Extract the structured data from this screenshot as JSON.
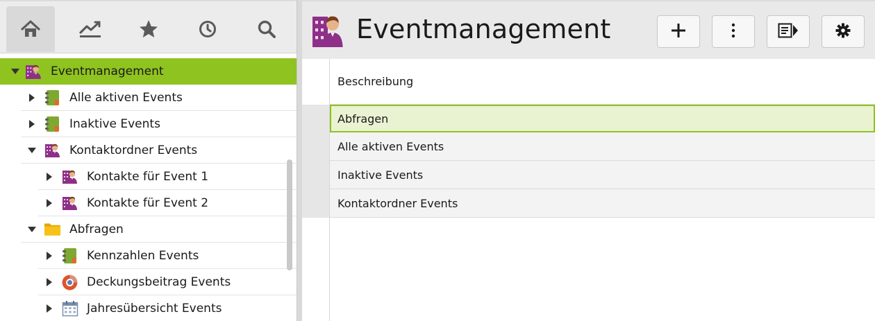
{
  "sidebar": {
    "tabs": [
      {
        "name": "home-icon",
        "active": true
      },
      {
        "name": "chart-trend-icon",
        "active": false
      },
      {
        "name": "star-icon",
        "active": false
      },
      {
        "name": "clock-icon",
        "active": false
      },
      {
        "name": "search-icon",
        "active": false
      }
    ],
    "tree": [
      {
        "label": "Eventmanagement",
        "level": 0,
        "expanded": true,
        "selected": true,
        "icon": "contact-folder-icon"
      },
      {
        "label": "Alle aktiven Events",
        "level": 1,
        "expanded": false,
        "selected": false,
        "icon": "notebook-icon"
      },
      {
        "label": "Inaktive Events",
        "level": 1,
        "expanded": false,
        "selected": false,
        "icon": "notebook-icon"
      },
      {
        "label": "Kontaktordner Events",
        "level": 1,
        "expanded": true,
        "selected": false,
        "icon": "contact-folder-icon"
      },
      {
        "label": "Kontakte für Event 1",
        "level": 2,
        "expanded": false,
        "selected": false,
        "icon": "contact-folder-icon"
      },
      {
        "label": "Kontakte für Event 2",
        "level": 2,
        "expanded": false,
        "selected": false,
        "icon": "contact-folder-icon"
      },
      {
        "label": "Abfragen",
        "level": 1,
        "expanded": true,
        "selected": false,
        "icon": "folder-icon"
      },
      {
        "label": "Kennzahlen Events",
        "level": 2,
        "expanded": false,
        "selected": false,
        "icon": "notebook-icon"
      },
      {
        "label": "Deckungsbeitrag Events",
        "level": 2,
        "expanded": false,
        "selected": false,
        "icon": "donut-chart-icon"
      },
      {
        "label": "Jahresübersicht Events",
        "level": 2,
        "expanded": false,
        "selected": false,
        "icon": "calendar-icon"
      }
    ]
  },
  "main": {
    "title": "Eventmanagement",
    "title_icon": "contact-folder-icon",
    "toolbar": [
      {
        "name": "add-button",
        "icon": "plus-icon"
      },
      {
        "name": "more-button",
        "icon": "vertical-dots-icon"
      },
      {
        "name": "details-panel-button",
        "icon": "panel-arrow-icon"
      },
      {
        "name": "settings-button",
        "icon": "gear-icon"
      }
    ],
    "grid": {
      "column_header": "Beschreibung",
      "rows": [
        {
          "label": "Abfragen",
          "selected": true
        },
        {
          "label": "Alle aktiven Events",
          "selected": false
        },
        {
          "label": "Inaktive Events",
          "selected": false
        },
        {
          "label": "Kontaktordner Events",
          "selected": false
        }
      ]
    }
  },
  "colors": {
    "accent_green": "#8fc31f",
    "selected_row_fill": "#e9f3d2",
    "contact_purple": "#8e2f88",
    "notebook_green": "#7ea832",
    "folder_yellow": "#f2b500",
    "chart_red": "#e0532a"
  }
}
